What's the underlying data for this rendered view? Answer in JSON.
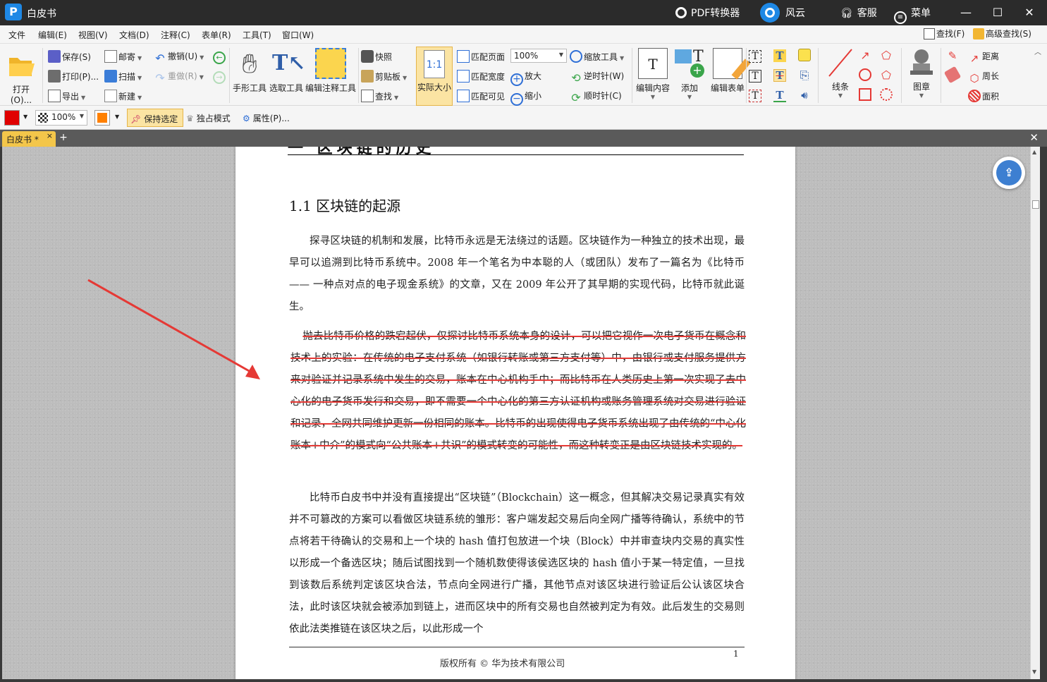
{
  "app": {
    "title": "白皮书",
    "logo_letter": "P",
    "pdf_converter": "PDF转换器",
    "fengyun": "风云",
    "service": "客服",
    "menu": "菜单"
  },
  "menubar": {
    "items": [
      "文件",
      "编辑(E)",
      "视图(V)",
      "文档(D)",
      "注释(C)",
      "表单(R)",
      "工具(T)",
      "窗口(W)"
    ],
    "find": "查找(F)",
    "advanced_find": "高级查找(S)"
  },
  "ribbon": {
    "open": "打开(O)...",
    "save": "保存(S)",
    "print": "打印(P)...",
    "export": "导出",
    "mail": "邮寄",
    "scan": "扫描",
    "new": "新建",
    "undo": "撤销(U)",
    "redo": "重做(R)",
    "hand_tool": "手形工具",
    "select_tool": "选取工具",
    "edit_annot_tool": "编辑注释工具",
    "snapshot": "快照",
    "clipboard": "剪贴板",
    "search": "查找",
    "actual_size": "实际大小",
    "fit_page": "匹配页面",
    "fit_width": "匹配宽度",
    "fit_visible": "匹配可见",
    "zoom_value": "100%",
    "zoom_tool": "缩放工具",
    "zoom_in": "放大",
    "zoom_out": "缩小",
    "rotate_ccw": "逆时针(W)",
    "rotate_cw": "顺时针(C)",
    "edit_content": "编辑内容",
    "add": "添加",
    "edit_form": "编辑表单",
    "lines": "线条",
    "stamp": "图章",
    "distance": "距离",
    "perimeter": "周长",
    "area": "面积"
  },
  "propbar": {
    "color": "#e00000",
    "opacity": "100%",
    "fill_color": "#ff8000",
    "keep_selected": "保持选定",
    "exclusive_mode": "独占模式",
    "properties": "属性(P)..."
  },
  "tabs": {
    "active": "白皮书 *",
    "close": "×",
    "add": "+"
  },
  "document": {
    "cut_heading": "一 区块链的历史",
    "section_title": "1.1 区块链的起源",
    "paragraph1": "探寻区块链的机制和发展，比特币永远是无法绕过的话题。区块链作为一种独立的技术出现，最早可以追溯到比特币系统中。2008 年一个笔名为中本聪的人（或团队）发布了一篇名为《比特币 —— 一种点对点的电子现金系统》的文章，又在 2009 年公开了其早期的实现代码，比特币就此诞生。",
    "paragraph2_struck": "抛去比特币价格的跌宕起伏，仅探讨比特币系统本身的设计，可以把它视作一次电子货币在概念和技术上的实验：在传统的电子支付系统（如银行转账或第三方支付等）中，由银行或支付服务提供方来对验证并记录系统中发生的交易，账本在中心机构手中；而比特币在人类历史上第一次实现了去中心化的电子货币发行和交易，即不需要一个中心化的第三方认证机构或账务管理系统对交易进行验证和记录，全网共同维护更新一份相同的账本。比特币的出现使得电子货币系统出现了由传统的“中心化账本+中介”的模式向“公共账本+共识”的模式转变的可能性，而这种转变正是由区块链技术实现的。",
    "paragraph3": "比特币白皮书中并没有直接提出“区块链”（Blockchain）这一概念，但其解决交易记录真实有效并不可篡改的方案可以看做区块链系统的雏形：客户端发起交易后向全网广播等待确认，系统中的节点将若干待确认的交易和上一个块的 hash 值打包放进一个块（Block）中并审查块内交易的真实性以形成一个备选区块；随后试图找到一个随机数使得该侯选区块的 hash 值小于某一特定值，一旦找到该数后系统判定该区块合法，节点向全网进行广播，其他节点对该区块进行验证后公认该区块合法，此时该区块就会被添加到链上，进而区块中的所有交易也自然被判定为有效。此后发生的交易则依此法类推链在该区块之后，以此形成一个",
    "page_number": "1",
    "footer": "版权所有 © 华为技术有限公司"
  },
  "colors": {
    "titlebar": "#2b2b2b",
    "accent": "#1e88e5",
    "tab_active": "#f3c64a",
    "strike": "#e53935",
    "arrow": "#e53935"
  }
}
